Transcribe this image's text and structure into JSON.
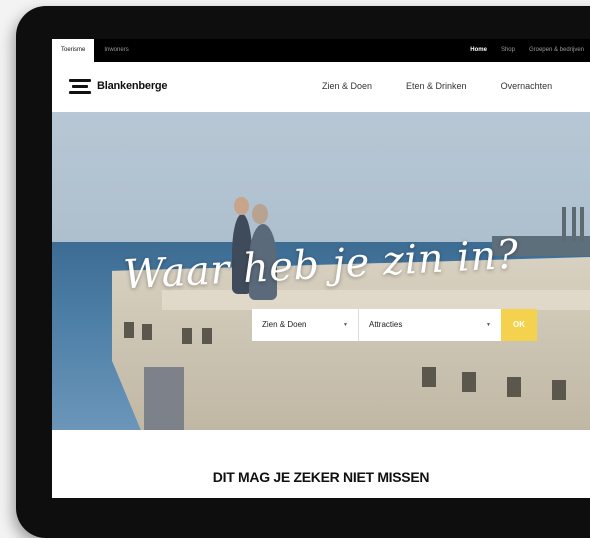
{
  "topbar": {
    "audience_tabs": [
      "Toerisme",
      "Inwoners"
    ],
    "utility_links": [
      "Home",
      "Shop",
      "Groepen & bedrijven"
    ]
  },
  "header": {
    "brand": "Blankenberge",
    "nav": [
      "Zien & Doen",
      "Eten & Drinken",
      "Overnachten"
    ]
  },
  "hero": {
    "headline": "Waar heb je zin in?",
    "search": {
      "category_value": "Zien & Doen",
      "subcategory_value": "Attracties",
      "submit_label": "OK"
    }
  },
  "section": {
    "title": "DIT MAG JE ZEKER NIET MISSEN"
  },
  "colors": {
    "accent": "#f5d24d",
    "topbar": "#000000",
    "sea": "#4d7ea6"
  }
}
